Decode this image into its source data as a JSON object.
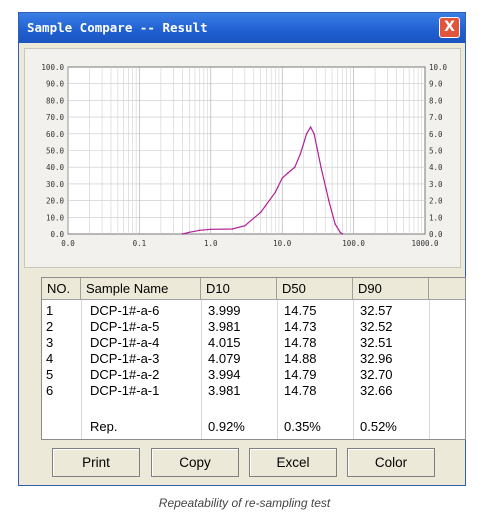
{
  "window": {
    "title": "Sample Compare -- Result",
    "close_label": "X"
  },
  "chart_data": {
    "type": "line",
    "x_scale": "log",
    "xlim": [
      0.0,
      1000.0
    ],
    "x_tick_labels": [
      "0.0",
      "0.1",
      "1.0",
      "10.0",
      "100.0",
      "1000.0"
    ],
    "ylim": [
      0,
      100
    ],
    "y_left_tick_labels": [
      "0.0",
      "10.0",
      "20.0",
      "30.0",
      "40.0",
      "50.0",
      "60.0",
      "70.0",
      "80.0",
      "90.0",
      "100.0"
    ],
    "y_right_tick_labels": [
      "0.0",
      "1.0",
      "2.0",
      "3.0",
      "4.0",
      "5.0",
      "6.0",
      "7.0",
      "8.0",
      "9.0",
      "10.0"
    ],
    "line_color": "#b0209a",
    "points": [
      [
        0.4,
        0.0
      ],
      [
        0.5,
        1.0
      ],
      [
        0.7,
        2.2
      ],
      [
        1.0,
        2.8
      ],
      [
        2.0,
        3.0
      ],
      [
        3.0,
        5.0
      ],
      [
        5.0,
        13.0
      ],
      [
        8.0,
        25.0
      ],
      [
        10.0,
        33.5
      ],
      [
        12.0,
        36.5
      ],
      [
        15.0,
        40.0
      ],
      [
        18.0,
        48.0
      ],
      [
        22.0,
        60.0
      ],
      [
        25.0,
        64.0
      ],
      [
        28.0,
        60.0
      ],
      [
        35.0,
        40.0
      ],
      [
        45.0,
        20.0
      ],
      [
        55.0,
        6.0
      ],
      [
        65.0,
        1.0
      ],
      [
        70.0,
        0.0
      ]
    ]
  },
  "table": {
    "headers": [
      "NO.",
      "Sample Name",
      "D10",
      "D50",
      "D90"
    ],
    "rows": [
      [
        "1",
        "DCP-1#-a-6",
        "3.999",
        "14.75",
        "32.57"
      ],
      [
        "2",
        "DCP-1#-a-5",
        "3.981",
        "14.73",
        "32.52"
      ],
      [
        "3",
        "DCP-1#-a-4",
        "4.015",
        "14.78",
        "32.51"
      ],
      [
        "4",
        "DCP-1#-a-3",
        "4.079",
        "14.88",
        "32.96"
      ],
      [
        "5",
        "DCP-1#-a-2",
        "3.994",
        "14.79",
        "32.70"
      ],
      [
        "6",
        "DCP-1#-a-1",
        "3.981",
        "14.78",
        "32.66"
      ]
    ],
    "rep": {
      "label": "Rep.",
      "d10": "0.92%",
      "d50": "0.35%",
      "d90": "0.52%"
    }
  },
  "buttons": {
    "print": "Print",
    "copy": "Copy",
    "excel": "Excel",
    "color": "Color"
  },
  "caption": "Repeatability of re-sampling test"
}
